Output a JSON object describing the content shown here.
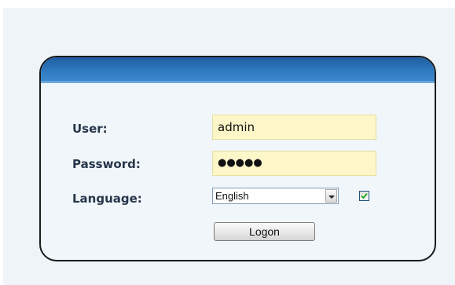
{
  "login": {
    "user_label": "User:",
    "user_value": "admin",
    "password_label": "Password:",
    "password_masked": "●●●●●",
    "language_label": "Language:",
    "language_selected": "English",
    "remember_checked": true,
    "logon_label": "Logon"
  },
  "colors": {
    "header_blue": "#2f7bc2",
    "input_fill": "#fdf6c9",
    "label_text": "#26364a"
  },
  "icons": {
    "dropdown": "chevron-down-icon",
    "checkbox": "checkmark-icon"
  }
}
